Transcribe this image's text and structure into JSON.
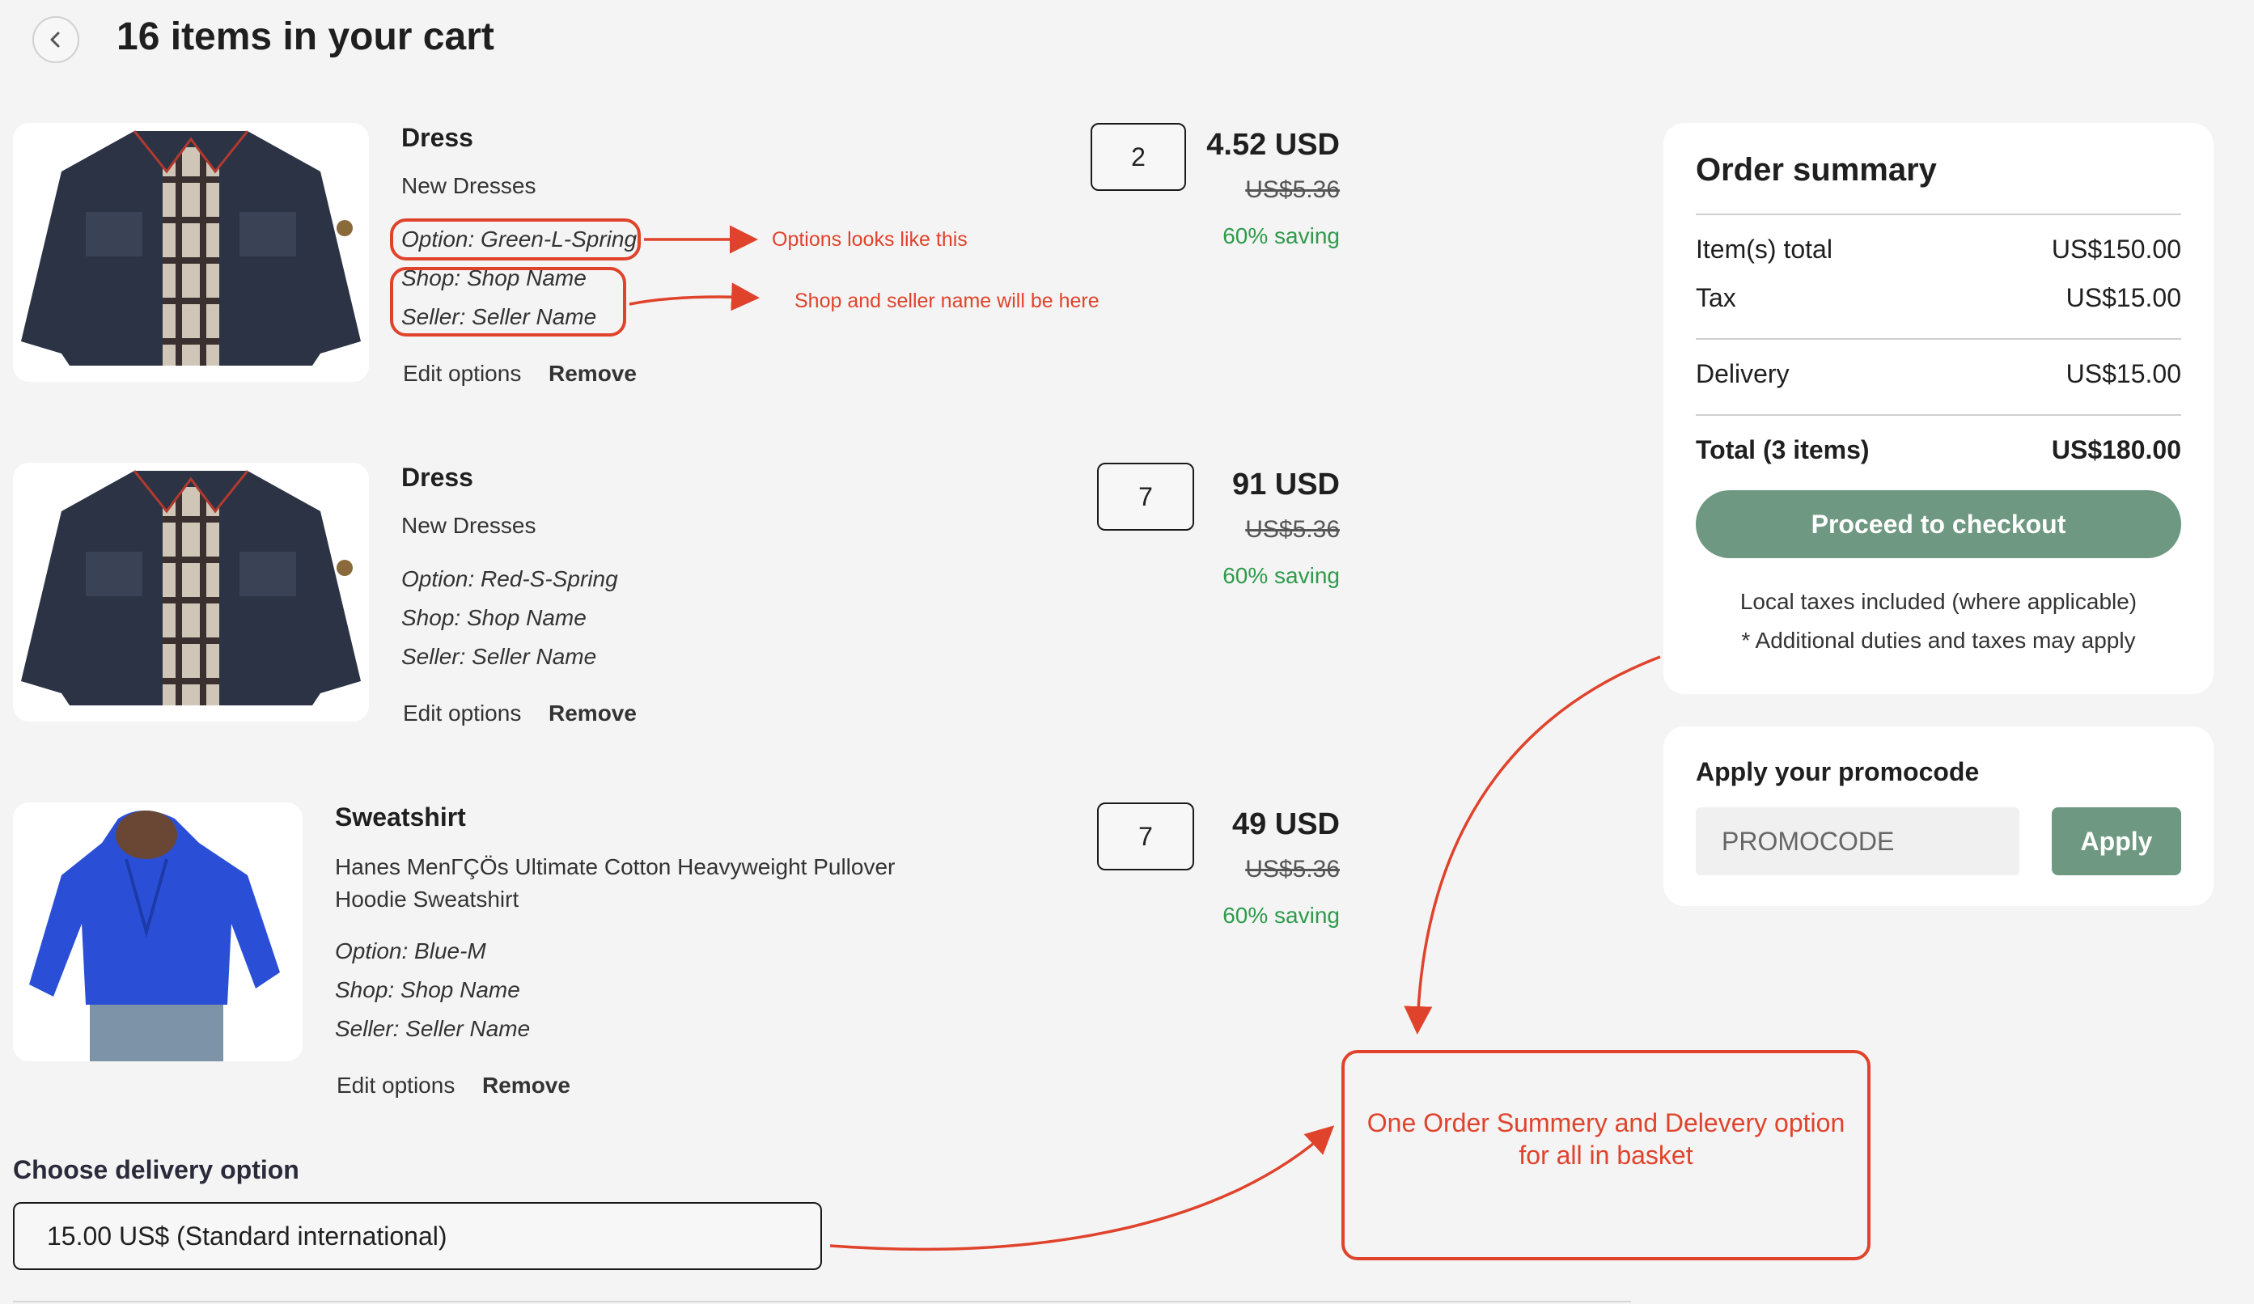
{
  "header": {
    "title": "16 items in your cart",
    "back_icon": "chevron-left-icon"
  },
  "items": [
    {
      "title": "Dress",
      "subtitle": "New Dresses",
      "option": "Option: Green-L-Spring",
      "shop": "Shop: Shop Name",
      "seller": "Seller: Seller Name",
      "edit_label": "Edit options",
      "remove_label": "Remove",
      "quantity": "2",
      "price": "4.52 USD",
      "old_price": "US$5.36",
      "saving": "60% saving"
    },
    {
      "title": "Dress",
      "subtitle": "New Dresses",
      "option": "Option: Red-S-Spring",
      "shop": "Shop: Shop Name",
      "seller": "Seller: Seller Name",
      "edit_label": "Edit options",
      "remove_label": "Remove",
      "quantity": "7",
      "price": "91 USD",
      "old_price": "US$5.36",
      "saving": "60% saving"
    },
    {
      "title": "Sweatshirt",
      "description_line1": "Hanes MenΓÇÖs Ultimate Cotton Heavyweight Pullover",
      "description_line2": "Hoodie Sweatshirt",
      "option": "Option: Blue-M",
      "shop": "Shop: Shop Name",
      "seller": "Seller: Seller Name",
      "edit_label": "Edit options",
      "remove_label": "Remove",
      "quantity": "7",
      "price": "49 USD",
      "old_price": "US$5.36",
      "saving": "60% saving"
    }
  ],
  "annotations": {
    "options_note": "Options looks like this",
    "shop_note": "Shop and seller name will be here",
    "summary_note_line1": "One Order Summery and Delevery option",
    "summary_note_line2": "for all in basket"
  },
  "order_summary": {
    "title": "Order summary",
    "items_total_label": "Item(s) total",
    "items_total_value": "US$150.00",
    "tax_label": "Tax",
    "tax_value": "US$15.00",
    "delivery_label": "Delivery",
    "delivery_value": "US$15.00",
    "total_label": "Total (3 items)",
    "total_value": "US$180.00",
    "checkout_label": "Proceed to checkout",
    "note1": "Local taxes included (where applicable)",
    "note2": "* Additional duties and taxes may apply"
  },
  "promo": {
    "title": "Apply your promocode",
    "placeholder": "PROMOCODE",
    "apply_label": "Apply"
  },
  "delivery": {
    "label": "Choose delivery option",
    "selected": "15.00 US$ (Standard international)"
  },
  "colors": {
    "accent_green": "#6e9882",
    "saving_green": "#2e9b4b",
    "annotation_red": "#e0432c"
  }
}
